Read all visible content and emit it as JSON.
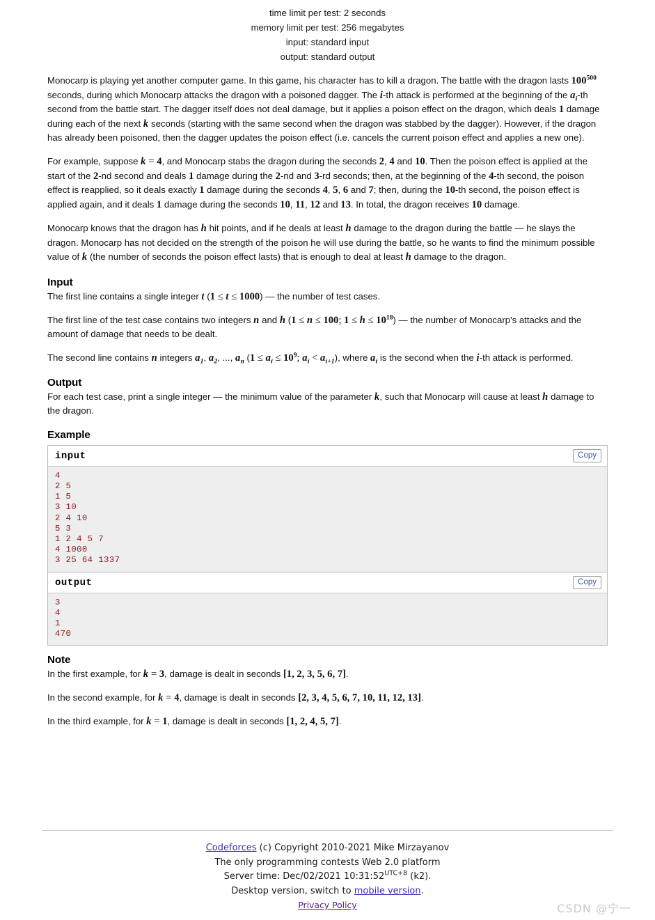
{
  "limits": {
    "time": "time limit per test: 2 seconds",
    "memory": "memory limit per test: 256 megabytes",
    "input": "input: standard input",
    "output": "output: standard output"
  },
  "statement": {
    "p1_a": "Monocarp is playing yet another computer game. In this game, his character has to kill a dragon. The battle with the dragon lasts ",
    "p1_pow_base": "100",
    "p1_pow_exp": "500",
    "p1_b": " seconds, during which Monocarp attacks the dragon with a poisoned dagger. The ",
    "p1_i": "i",
    "p1_c": "-th attack is performed at the beginning of the ",
    "p1_a_var": "a",
    "p1_a_sub": "i",
    "p1_d": "-th second from the battle start. The dagger itself does not deal damage, but it applies a poison effect on the dragon, which deals ",
    "p1_one": "1",
    "p1_e": " damage during each of the next ",
    "p1_k": "k",
    "p1_f": " seconds (starting with the same second when the dragon was stabbed by the dagger). However, if the dragon has already been poisoned, then the dagger updates the poison effect (i.e. cancels the current poison effect and applies a new one).",
    "p2_a": "For example, suppose ",
    "p2_k": "k",
    "p2_eq": " = ",
    "p2_4": "4",
    "p2_b": ", and Monocarp stabs the dragon during the seconds ",
    "p2_2": "2",
    "p2_c": ", ",
    "p2_4b": "4",
    "p2_d": " and ",
    "p2_10": "10",
    "p2_e": ". Then the poison effect is applied at the start of the ",
    "p2_2b": "2",
    "p2_f": "-nd second and deals ",
    "p2_1": "1",
    "p2_g": " damage during the ",
    "p2_2c": "2",
    "p2_h": "-nd and ",
    "p2_3": "3",
    "p2_i": "-rd seconds; then, at the beginning of the ",
    "p2_4c": "4",
    "p2_j": "-th second, the poison effect is reapplied, so it deals exactly ",
    "p2_1b": "1",
    "p2_k2": " damage during the seconds ",
    "p2_4d": "4",
    "p2_l": ", ",
    "p2_5": "5",
    "p2_m": ", ",
    "p2_6": "6",
    "p2_n": " and ",
    "p2_7": "7",
    "p2_o": "; then, during the ",
    "p2_10b": "10",
    "p2_p": "-th second, the poison effect is applied again, and it deals ",
    "p2_1c": "1",
    "p2_q": " damage during the seconds ",
    "p2_10c": "10",
    "p2_r": ", ",
    "p2_11": "11",
    "p2_s": ", ",
    "p2_12": "12",
    "p2_t": " and ",
    "p2_13": "13",
    "p2_u": ". In total, the dragon receives ",
    "p2_10d": "10",
    "p2_v": " damage.",
    "p3_a": "Monocarp knows that the dragon has ",
    "p3_h": "h",
    "p3_b": " hit points, and if he deals at least ",
    "p3_h2": "h",
    "p3_c": " damage to the dragon during the battle — he slays the dragon. Monocarp has not decided on the strength of the poison he will use during the battle, so he wants to find the minimum possible value of ",
    "p3_k": "k",
    "p3_d": " (the number of seconds the poison effect lasts) that is enough to deal at least ",
    "p3_h3": "h",
    "p3_e": " damage to the dragon."
  },
  "input_section": {
    "title": "Input",
    "l1_a": "The first line contains a single integer ",
    "l1_t": "t",
    "l1_b": " (",
    "l1_1": "1",
    "l1_le1": " ≤ ",
    "l1_t2": "t",
    "l1_le2": " ≤ ",
    "l1_1000": "1000",
    "l1_c": ") — the number of test cases.",
    "l2_a": "The first line of the test case contains two integers ",
    "l2_n": "n",
    "l2_b": " and ",
    "l2_h": "h",
    "l2_c": " (",
    "l2_1": "1",
    "l2_le1": " ≤ ",
    "l2_n2": "n",
    "l2_le2": " ≤ ",
    "l2_100": "100",
    "l2_semi": "; ",
    "l2_1b": "1",
    "l2_le3": " ≤ ",
    "l2_h2": "h",
    "l2_le4": " ≤ ",
    "l2_pow_base": "10",
    "l2_pow_exp": "18",
    "l2_d": ") — the number of Monocarp's attacks and the amount of damage that needs to be dealt.",
    "l3_a": "The second line contains ",
    "l3_n": "n",
    "l3_b": " integers ",
    "l3_a1": "a",
    "l3_a1s": "1",
    "l3_c": ", ",
    "l3_a2": "a",
    "l3_a2s": "2",
    "l3_d": ", ..., ",
    "l3_an": "a",
    "l3_ans": "n",
    "l3_e": " (",
    "l3_1": "1",
    "l3_le1": " ≤ ",
    "l3_ai": "a",
    "l3_ais": "i",
    "l3_le2": " ≤ ",
    "l3_pow_base": "10",
    "l3_pow_exp": "9",
    "l3_semi": "; ",
    "l3_ai2": "a",
    "l3_ai2s": "i",
    "l3_lt": " < ",
    "l3_ai3": "a",
    "l3_ai3s": "i+1",
    "l3_f": "), where ",
    "l3_ai4": "a",
    "l3_ai4s": "i",
    "l3_g": " is the second when the ",
    "l3_i": "i",
    "l3_h": "-th attack is performed."
  },
  "output_section": {
    "title": "Output",
    "a": "For each test case, print a single integer — the minimum value of the parameter ",
    "k": "k",
    "b": ", such that Monocarp will cause at least ",
    "h": "h",
    "c": " damage to the dragon."
  },
  "example": {
    "title": "Example",
    "input_label": "input",
    "output_label": "output",
    "copy_label": "Copy",
    "input_text": "4\n2 5\n1 5\n3 10\n2 4 10\n5 3\n1 2 4 5 7\n4 1000\n3 25 64 1337",
    "output_text": "3\n4\n1\n470"
  },
  "note_section": {
    "title": "Note",
    "n1_a": "In the first example, for ",
    "n1_k": "k",
    "n1_eq": " = ",
    "n1_v": "3",
    "n1_b": ", damage is dealt in seconds ",
    "n1_list": "[1, 2, 3, 5, 6, 7]",
    "n1_c": ".",
    "n2_a": "In the second example, for ",
    "n2_k": "k",
    "n2_eq": " = ",
    "n2_v": "4",
    "n2_b": ", damage is dealt in seconds ",
    "n2_list": "[2, 3, 4, 5, 6, 7, 10, 11, 12, 13]",
    "n2_c": ".",
    "n3_a": "In the third example, for ",
    "n3_k": "k",
    "n3_eq": " = ",
    "n3_v": "1",
    "n3_b": ", damage is dealt in seconds ",
    "n3_list": "[1, 2, 4, 5, 7]",
    "n3_c": "."
  },
  "footer": {
    "codeforces_link": "Codeforces",
    "copyright": " (c) Copyright 2010-2021 Mike Mirzayanov",
    "tagline": "The only programming contests Web 2.0 platform",
    "server_time_prefix": "Server time: Dec/02/2021 10:31:52",
    "utc": "UTC+8",
    "server_time_suffix": " (k2).",
    "desktop_prefix": "Desktop version, switch to ",
    "mobile_link": "mobile version",
    "desktop_suffix": ".",
    "privacy_link": "Privacy Policy"
  },
  "watermark": "CSDN @宁一"
}
